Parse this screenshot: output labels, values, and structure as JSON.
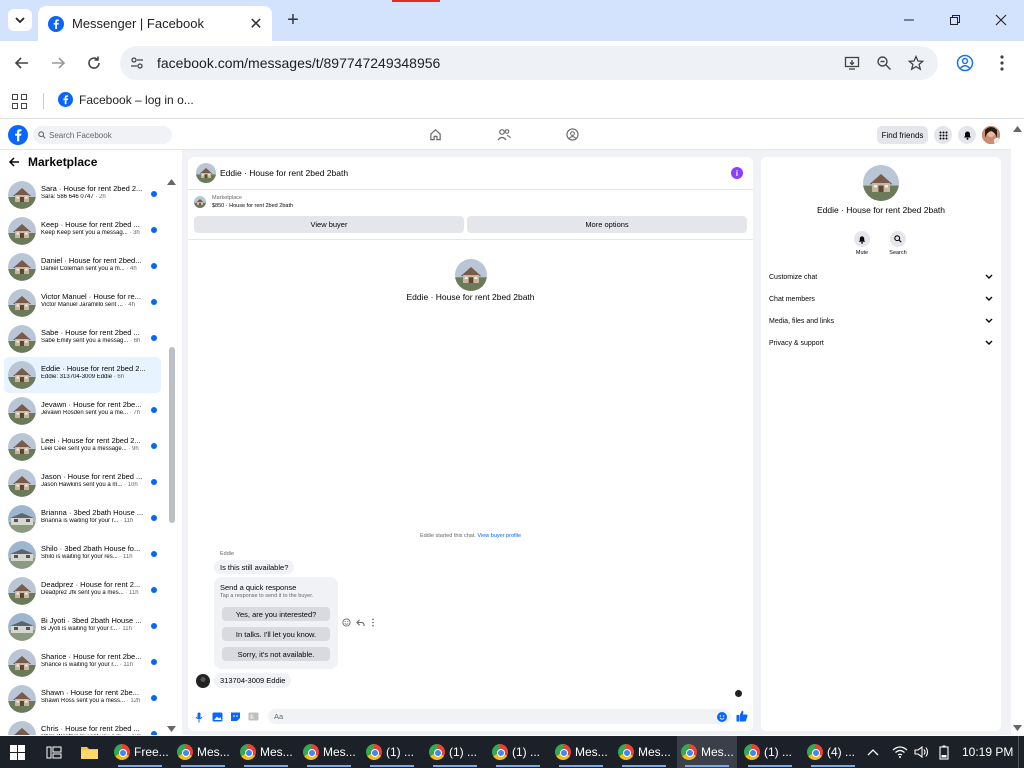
{
  "browser": {
    "tab_title": "Messenger | Facebook",
    "url": "facebook.com/messages/t/897747249348956",
    "bookmark": "Facebook – log in o..."
  },
  "fb": {
    "search_placeholder": "Search Facebook",
    "find_friends": "Find friends"
  },
  "marketplace": {
    "header": "Marketplace",
    "conversations": [
      {
        "title": "Sara · House for rent 2bed 2...",
        "preview": "Sara: 586 646 0747",
        "time": " · 2h",
        "unread": true
      },
      {
        "title": "Keep · House for rent 2bed ...",
        "preview": "Keep Keep sent you a messag...",
        "time": " · 3h",
        "unread": true
      },
      {
        "title": "Daniel · House for rent 2bed...",
        "preview": "Daniel Coleman sent you a m...",
        "time": " · 4h",
        "unread": true
      },
      {
        "title": "Victor Manuel · House for re...",
        "preview": "Victor Manuel Jaramillo sent ...",
        "time": " · 4h",
        "unread": true
      },
      {
        "title": "Sabe · House for rent 2bed ...",
        "preview": "Sabe Emily sent you a messag...",
        "time": " · 6h",
        "unread": true
      },
      {
        "title": "Eddie · House for rent 2bed 2...",
        "preview": "Eddie: 313704-3009 Eddie",
        "time": " · 6h",
        "unread": false,
        "active": true
      },
      {
        "title": "Jevawn · House for rent 2be...",
        "preview": "Jevawn Rosden sent you a me...",
        "time": " · 7h",
        "unread": true
      },
      {
        "title": "Leei · House for rent 2bed 2...",
        "preview": "Leei Ceei sent you a message...",
        "time": " · 9h",
        "unread": true
      },
      {
        "title": "Jason · House for rent 2bed ...",
        "preview": "Jason Hawkins sent you a m...",
        "time": " · 10h",
        "unread": true
      },
      {
        "title": "Brianna · 3bed 2bath House ...",
        "preview": "Brianna is waiting for your r...",
        "time": " · 11h",
        "unread": true
      },
      {
        "title": "Shilo · 3bed 2bath House fo...",
        "preview": "Shilo is waiting for your res...",
        "time": " · 11h",
        "unread": true
      },
      {
        "title": "Deadprez · House for rent 2...",
        "preview": "Deadprez Jfk sent you a mes...",
        "time": " · 11h",
        "unread": true
      },
      {
        "title": "Bi Jyoti · 3bed 2bath House ...",
        "preview": "Bi Jyoti is waiting for your r...",
        "time": " · 11h",
        "unread": true
      },
      {
        "title": "Sharice · House for rent 2be...",
        "preview": "Sharice is waiting for your r...",
        "time": " · 11h",
        "unread": true
      },
      {
        "title": "Shawn · House for rent 2be...",
        "preview": "Shawn Ross sent you a mess...",
        "time": " · 12h",
        "unread": true
      },
      {
        "title": "Chris · House for rent 2bed ...",
        "preview": "Chris Westbrook sent you a m...",
        "time": " · 13h",
        "unread": true
      }
    ]
  },
  "chat": {
    "title": "Eddie · House for rent 2bed 2bath",
    "info_icon": "i",
    "listing_label": "Marketplace",
    "listing_detail": "$850 · House for rent 2bed 2bath",
    "view_buyer": "View buyer",
    "more_options": "More options",
    "intro_name": "Eddie · House for rent 2bed 2bath",
    "started_text": "Eddie started this chat.",
    "view_buyer_profile": "View buyer profile",
    "sender_label": "Eddie",
    "message1": "Is this still available?",
    "quick_title": "Send a quick response",
    "quick_sub": "Tap a response to send it to the buyer.",
    "quick_replies": [
      "Yes, are you interested?",
      "In talks. I'll let you know.",
      "Sorry, it's not available."
    ],
    "message2": "313704-3009 Eddie",
    "composer_placeholder": "Aa"
  },
  "right_panel": {
    "name": "Eddie · House for rent 2bed 2bath",
    "mute": "Mute",
    "search": "Search",
    "sections": [
      "Customize chat",
      "Chat members",
      "Media, files and links",
      "Privacy & support"
    ]
  },
  "taskbar": {
    "items": [
      {
        "label": "Free..."
      },
      {
        "label": "Mes..."
      },
      {
        "label": "Mes..."
      },
      {
        "label": "Mes..."
      },
      {
        "label": "(1) ..."
      },
      {
        "label": "(1) ..."
      },
      {
        "label": "(1) ..."
      },
      {
        "label": "Mes..."
      },
      {
        "label": "Mes..."
      },
      {
        "label": "Mes...",
        "active": true
      },
      {
        "label": "(1) ..."
      },
      {
        "label": "(4) ..."
      }
    ],
    "clock": "10:19 PM"
  },
  "colors": {
    "fb_blue": "#0866ff",
    "tabstrip": "#d3e3fd",
    "taskbar": "#1c2028"
  }
}
